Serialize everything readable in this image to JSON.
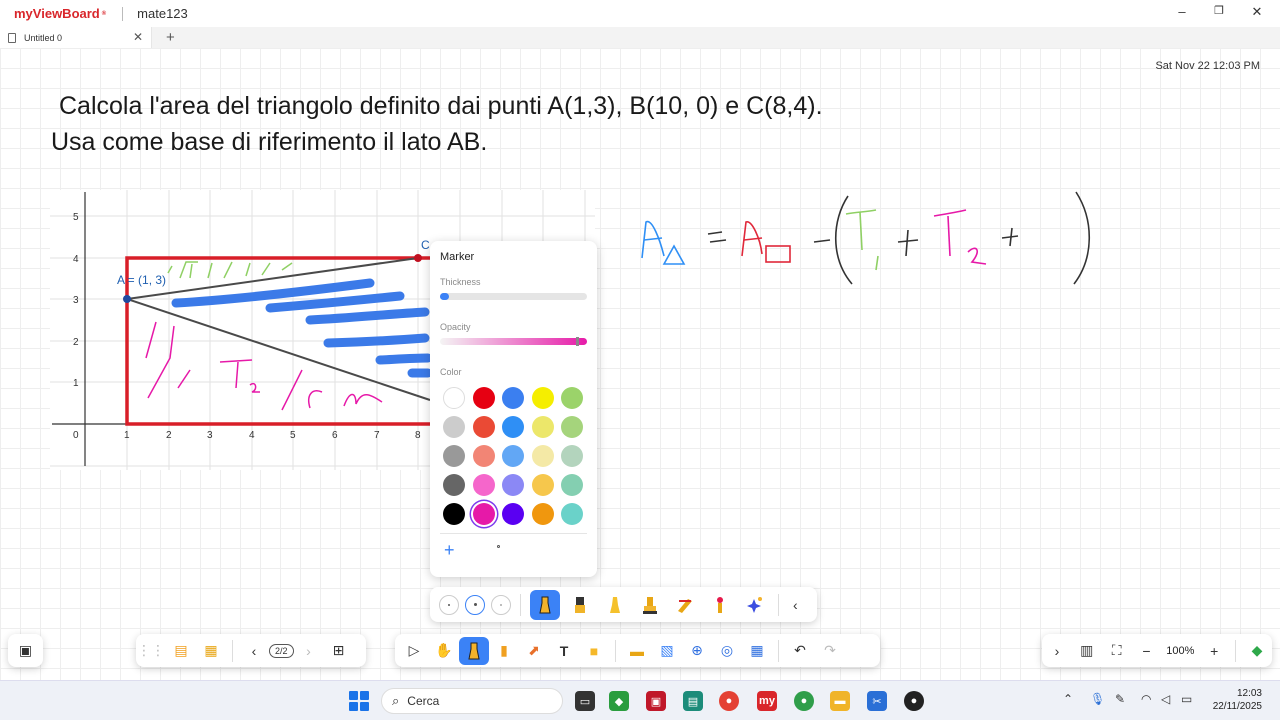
{
  "app": {
    "logo": "myViewBoard",
    "document_title": "mate123",
    "window_controls": [
      "–",
      "❐",
      "✕"
    ]
  },
  "tabs": [
    {
      "label": "Untitled 0"
    }
  ],
  "canvas": {
    "datetime": "Sat Nov 22  12:03 PM",
    "problem_line1": "Calcola l'area del triangolo definito dai punti A(1,3), B(10, 0) e C(8,4).",
    "problem_line2": "Usa come base di riferimento il lato AB.",
    "graph": {
      "x_ticks": [
        "0",
        "1",
        "2",
        "3",
        "4",
        "5",
        "6",
        "7",
        "8"
      ],
      "y_ticks": [
        "1",
        "2",
        "3",
        "4",
        "5"
      ],
      "point_a_label": "A = (1, 3)",
      "point_c_label": "C"
    }
  },
  "marker_panel": {
    "title": "Marker",
    "thickness_label": "Thickness",
    "thickness_value": 0.06,
    "opacity_label": "Opacity",
    "opacity_value": 0.95,
    "color_label": "Color",
    "selected_color": "#e619a8",
    "colors": [
      "#ffffff",
      "#e60012",
      "#3b7ff0",
      "#f5ee00",
      "#9bd36a",
      "#cccccc",
      "#ea4a35",
      "#2f8ff5",
      "#ece76a",
      "#a5d47c",
      "#999999",
      "#f28575",
      "#62a7f5",
      "#f4e9a6",
      "#b3d4bd",
      "#666666",
      "#f566cb",
      "#8b88f5",
      "#f6c74c",
      "#84cfb1",
      "#000000",
      "#e619a8",
      "#5a00f2",
      "#f0970e",
      "#6ad2c9"
    ]
  },
  "toolbar": {
    "page_indicator": "2/2",
    "zoom": "100%"
  },
  "taskbar": {
    "search_placeholder": "Cerca",
    "time": "12:03",
    "date": "22/11/2025"
  }
}
